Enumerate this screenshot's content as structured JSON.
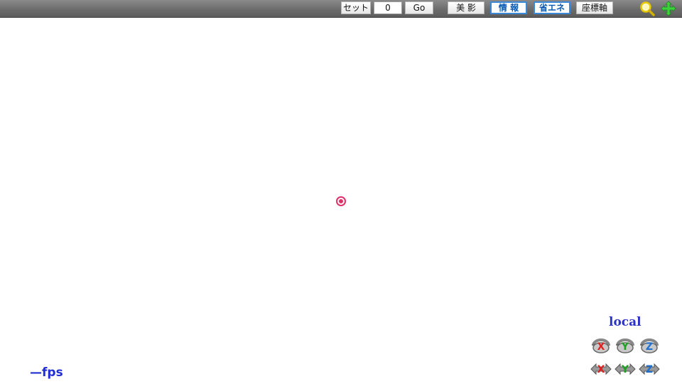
{
  "toolbar": {
    "set_label": "セット",
    "frame_value": "0",
    "go_label": "Go",
    "beauty_shadow_label": "美 影",
    "info_label": "情 報",
    "energy_save_label": "省エネ",
    "axes_label": "座標軸",
    "icons": [
      "magnifier-icon",
      "move-cross-icon"
    ],
    "active": [
      "info",
      "energy_save"
    ]
  },
  "viewport": {
    "center_marker_icon": "target-circle-icon",
    "center_marker_color": "#e0306a"
  },
  "status": {
    "fps_text": "—fps"
  },
  "rotation_panel": {
    "mode_label": "local",
    "rows": [
      [
        {
          "axis": "X",
          "color": "#e02020",
          "icon": "rotate-x-icon"
        },
        {
          "axis": "Y",
          "color": "#20a020",
          "icon": "rotate-y-icon"
        },
        {
          "axis": "Z",
          "color": "#2070d0",
          "icon": "rotate-z-icon"
        }
      ],
      [
        {
          "axis": "X",
          "color": "#e02020",
          "icon": "move-x-icon"
        },
        {
          "axis": "Y",
          "color": "#20a020",
          "icon": "move-y-icon"
        },
        {
          "axis": "Z",
          "color": "#2070d0",
          "icon": "move-z-icon"
        }
      ]
    ]
  }
}
